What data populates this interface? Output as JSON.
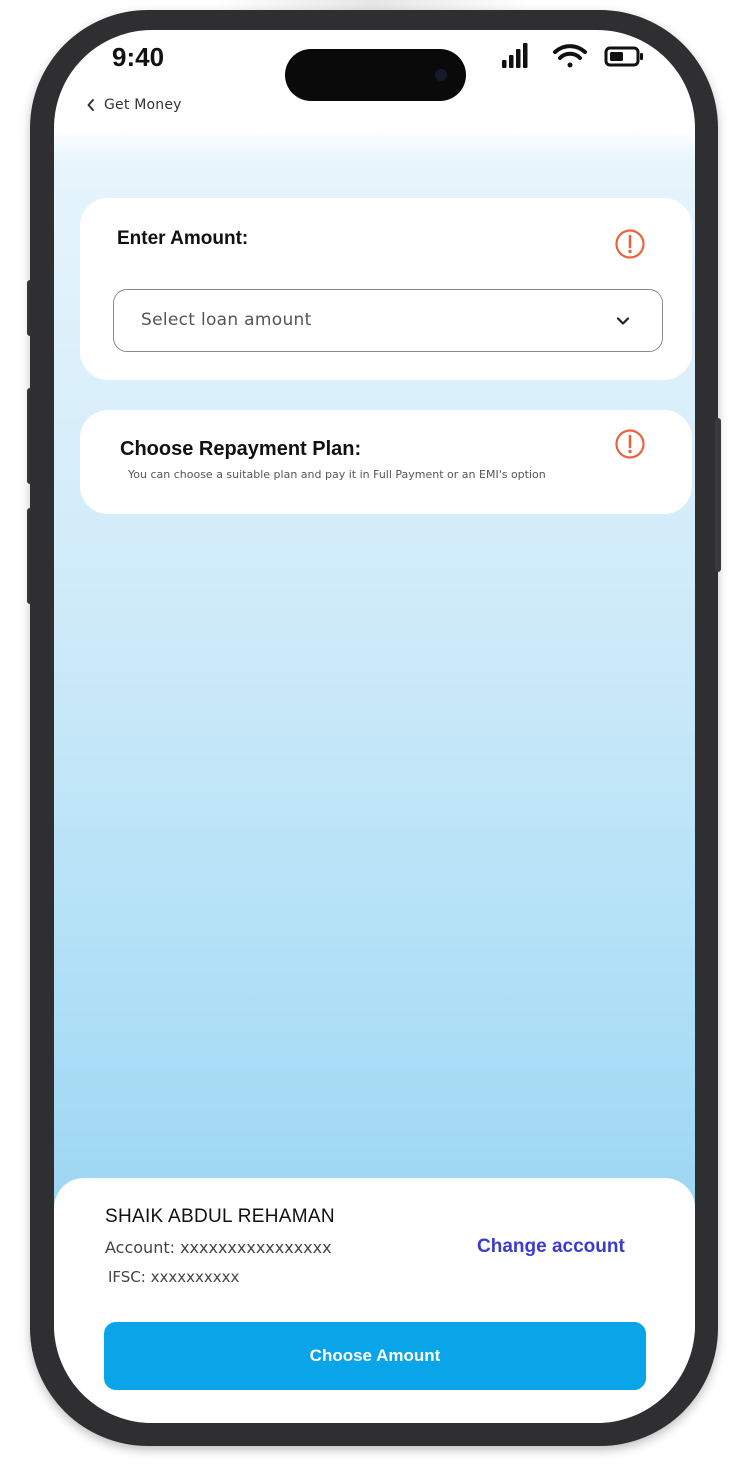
{
  "status_bar": {
    "time": "9:40"
  },
  "nav": {
    "back_label": "Get Money"
  },
  "amount_card": {
    "title": "Enter Amount:",
    "select_placeholder": "Select loan amount"
  },
  "plan_card": {
    "title": "Choose Repayment Plan:",
    "subtitle": "You can choose a suitable plan and pay it in Full Payment or an EMI's option"
  },
  "account": {
    "name": "SHAIK ABDUL REHAMAN",
    "account_line": "Account: xxxxxxxxxxxxxxxx",
    "ifsc_line": "IFSC: xxxxxxxxxx",
    "change_label": "Change account"
  },
  "primary_action": {
    "label": "Choose Amount"
  },
  "colors": {
    "accent": "#0aa4e8",
    "link": "#3b3ccf",
    "info": "#e8643a"
  },
  "icons": {
    "back": "chevron-left-icon",
    "info": "info-icon",
    "dropdown": "chevron-down-icon",
    "signal": "signal-icon",
    "wifi": "wifi-icon",
    "battery": "battery-icon"
  }
}
